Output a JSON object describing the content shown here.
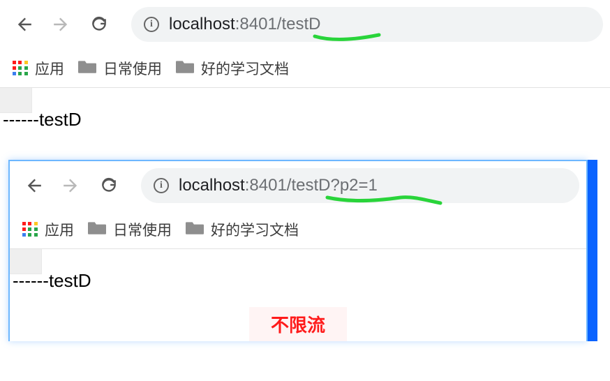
{
  "top": {
    "url_host": "localhost",
    "url_rest": ":8401/testD",
    "bookmarks": {
      "apps_label": "应用",
      "folder1": "日常使用",
      "folder2": "好的学习文档"
    },
    "page_body": "------testD"
  },
  "bottom": {
    "url_host": "localhost",
    "url_rest": ":8401/testD?p2=1",
    "bookmarks": {
      "apps_label": "应用",
      "folder1": "日常使用",
      "folder2": "好的学习文档"
    },
    "page_body": "------testD",
    "annotation": "不限流"
  },
  "apps_colors": [
    "#ff1b1b",
    "#ff1b1b",
    "#ffc820",
    "#ff1b1b",
    "#2aa64a",
    "#2aa64a",
    "#3b7ef0",
    "#2aa64a",
    "#2aa64a"
  ]
}
